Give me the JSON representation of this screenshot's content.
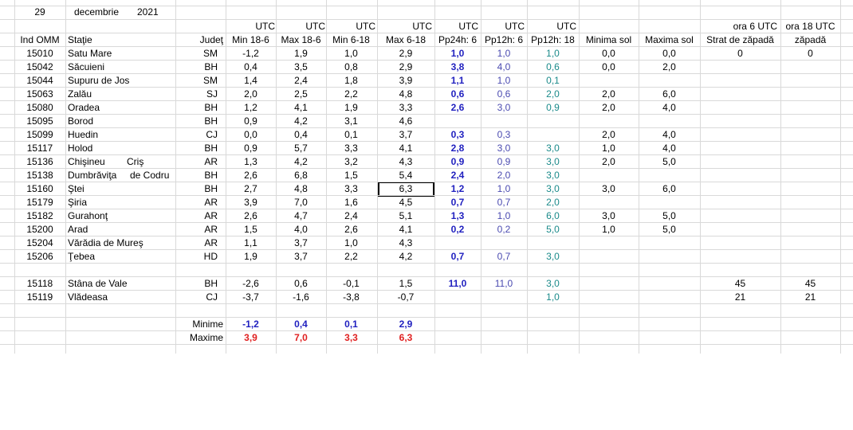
{
  "date": {
    "day": "29",
    "month": "decembrie",
    "year": "2021"
  },
  "header_utc": "UTC",
  "header_ora6": "ora 6 UTC",
  "header_ora18": "ora 18 UTC",
  "columns": {
    "ind": "Ind OMM",
    "statie": "Staţie",
    "judet": "Judeţ",
    "min186": "Min 18-6",
    "max186": "Max 18-6",
    "min618": "Min 6-18",
    "max618": "Max 6-18",
    "pp24": "Pp24h: 6",
    "pp12_6": "Pp12h: 6",
    "pp12_18": "Pp12h: 18",
    "minsol": "Minima sol",
    "maxsol": "Maxima sol",
    "strat": "Strat de zăpadă",
    "zapada": "zăpadă"
  },
  "rows": [
    {
      "ind": "15010",
      "statie": "Satu Mare",
      "extra": "",
      "judet": "SM",
      "min186": "-1,2",
      "max186": "1,9",
      "min618": "1,0",
      "max618": "2,9",
      "pp24": "1,0",
      "pp12_6": "1,0",
      "pp12_18": "1,0",
      "minsol": "0,0",
      "maxsol": "0,0",
      "strat": "0",
      "zapada": "0"
    },
    {
      "ind": "15042",
      "statie": "Săcuieni",
      "extra": "",
      "judet": "BH",
      "min186": "0,4",
      "max186": "3,5",
      "min618": "0,8",
      "max618": "2,9",
      "pp24": "3,8",
      "pp12_6": "4,0",
      "pp12_18": "0,6",
      "minsol": "0,0",
      "maxsol": "2,0",
      "strat": "",
      "zapada": ""
    },
    {
      "ind": "15044",
      "statie": "Supuru de Jos",
      "extra": "",
      "judet": "SM",
      "min186": "1,4",
      "max186": "2,4",
      "min618": "1,8",
      "max618": "3,9",
      "pp24": "1,1",
      "pp12_6": "1,0",
      "pp12_18": "0,1",
      "minsol": "",
      "maxsol": "",
      "strat": "",
      "zapada": ""
    },
    {
      "ind": "15063",
      "statie": "Zalău",
      "extra": "",
      "judet": "SJ",
      "min186": "2,0",
      "max186": "2,5",
      "min618": "2,2",
      "max618": "4,8",
      "pp24": "0,6",
      "pp12_6": "0,6",
      "pp12_18": "2,0",
      "minsol": "2,0",
      "maxsol": "6,0",
      "strat": "",
      "zapada": ""
    },
    {
      "ind": "15080",
      "statie": "Oradea",
      "extra": "",
      "judet": "BH",
      "min186": "1,2",
      "max186": "4,1",
      "min618": "1,9",
      "max618": "3,3",
      "pp24": "2,6",
      "pp12_6": "3,0",
      "pp12_18": "0,9",
      "minsol": "2,0",
      "maxsol": "4,0",
      "strat": "",
      "zapada": ""
    },
    {
      "ind": "15095",
      "statie": "Borod",
      "extra": "",
      "judet": "BH",
      "min186": "0,9",
      "max186": "4,2",
      "min618": "3,1",
      "max618": "4,6",
      "pp24": "",
      "pp12_6": "",
      "pp12_18": "",
      "minsol": "",
      "maxsol": "",
      "strat": "",
      "zapada": ""
    },
    {
      "ind": "15099",
      "statie": "Huedin",
      "extra": "",
      "judet": "CJ",
      "min186": "0,0",
      "max186": "0,4",
      "min618": "0,1",
      "max618": "3,7",
      "pp24": "0,3",
      "pp12_6": "0,3",
      "pp12_18": "",
      "minsol": "2,0",
      "maxsol": "4,0",
      "strat": "",
      "zapada": ""
    },
    {
      "ind": "15117",
      "statie": "Holod",
      "extra": "",
      "judet": "BH",
      "min186": "0,9",
      "max186": "5,7",
      "min618": "3,3",
      "max618": "4,1",
      "pp24": "2,8",
      "pp12_6": "3,0",
      "pp12_18": "3,0",
      "minsol": "1,0",
      "maxsol": "4,0",
      "strat": "",
      "zapada": ""
    },
    {
      "ind": "15136",
      "statie": "Chişineu",
      "extra": "Criş",
      "judet": "AR",
      "min186": "1,3",
      "max186": "4,2",
      "min618": "3,2",
      "max618": "4,3",
      "pp24": "0,9",
      "pp12_6": "0,9",
      "pp12_18": "3,0",
      "minsol": "2,0",
      "maxsol": "5,0",
      "strat": "",
      "zapada": ""
    },
    {
      "ind": "15138",
      "statie": "Dumbrăviţa",
      "extra": "de Codru",
      "judet": "BH",
      "min186": "2,6",
      "max186": "6,8",
      "min618": "1,5",
      "max618": "5,4",
      "pp24": "2,4",
      "pp12_6": "2,0",
      "pp12_18": "3,0",
      "minsol": "",
      "maxsol": "",
      "strat": "",
      "zapada": ""
    },
    {
      "ind": "15160",
      "statie": "Ştei",
      "extra": "",
      "judet": "BH",
      "min186": "2,7",
      "max186": "4,8",
      "min618": "3,3",
      "max618": "6,3",
      "pp24": "1,2",
      "pp12_6": "1,0",
      "pp12_18": "3,0",
      "minsol": "3,0",
      "maxsol": "6,0",
      "strat": "",
      "zapada": ""
    },
    {
      "ind": "15179",
      "statie": "Şiria",
      "extra": "",
      "judet": "AR",
      "min186": "3,9",
      "max186": "7,0",
      "min618": "1,6",
      "max618": "4,5",
      "pp24": "0,7",
      "pp12_6": "0,7",
      "pp12_18": "2,0",
      "minsol": "",
      "maxsol": "",
      "strat": "",
      "zapada": ""
    },
    {
      "ind": "15182",
      "statie": "Gurahonţ",
      "extra": "",
      "judet": "AR",
      "min186": "2,6",
      "max186": "4,7",
      "min618": "2,4",
      "max618": "5,1",
      "pp24": "1,3",
      "pp12_6": "1,0",
      "pp12_18": "6,0",
      "minsol": "3,0",
      "maxsol": "5,0",
      "strat": "",
      "zapada": ""
    },
    {
      "ind": "15200",
      "statie": "Arad",
      "extra": "",
      "judet": "AR",
      "min186": "1,5",
      "max186": "4,0",
      "min618": "2,6",
      "max618": "4,1",
      "pp24": "0,2",
      "pp12_6": "0,2",
      "pp12_18": "5,0",
      "minsol": "1,0",
      "maxsol": "5,0",
      "strat": "",
      "zapada": ""
    },
    {
      "ind": "15204",
      "statie": "Vărădia de Mureş",
      "extra": "",
      "judet": "AR",
      "min186": "1,1",
      "max186": "3,7",
      "min618": "1,0",
      "max618": "4,3",
      "pp24": "",
      "pp12_6": "",
      "pp12_18": "",
      "minsol": "",
      "maxsol": "",
      "strat": "",
      "zapada": ""
    },
    {
      "ind": "15206",
      "statie": "Ţebea",
      "extra": "",
      "judet": "HD",
      "min186": "1,9",
      "max186": "3,7",
      "min618": "2,2",
      "max618": "4,2",
      "pp24": "0,7",
      "pp12_6": "0,7",
      "pp12_18": "3,0",
      "minsol": "",
      "maxsol": "",
      "strat": "",
      "zapada": ""
    }
  ],
  "mountain_rows": [
    {
      "ind": "15118",
      "statie": "Stâna de Vale",
      "extra": "",
      "judet": "BH",
      "min186": "-2,6",
      "max186": "0,6",
      "min618": "-0,1",
      "max618": "1,5",
      "pp24": "11,0",
      "pp12_6": "11,0",
      "pp12_18": "3,0",
      "minsol": "",
      "maxsol": "",
      "strat": "45",
      "zapada": "45"
    },
    {
      "ind": "15119",
      "statie": "Vlădeasa",
      "extra": "",
      "judet": "CJ",
      "min186": "-3,7",
      "max186": "-1,6",
      "min618": "-3,8",
      "max618": "-0,7",
      "pp24": "",
      "pp12_6": "",
      "pp12_18": "1,0",
      "minsol": "",
      "maxsol": "",
      "strat": "21",
      "zapada": "21"
    }
  ],
  "summary": {
    "minime_label": "Minime",
    "maxime_label": "Maxime",
    "minime": {
      "min186": "-1,2",
      "max186": "0,4",
      "min618": "0,1",
      "max618": "2,9"
    },
    "maxime": {
      "min186": "3,9",
      "max186": "7,0",
      "min618": "3,3",
      "max618": "6,3"
    }
  },
  "colors": {
    "grid": "#d9d9d9",
    "navy": "#1f1fbf",
    "slate": "#4a4ab0",
    "teal": "#1a8a8a",
    "red": "#e02020"
  }
}
